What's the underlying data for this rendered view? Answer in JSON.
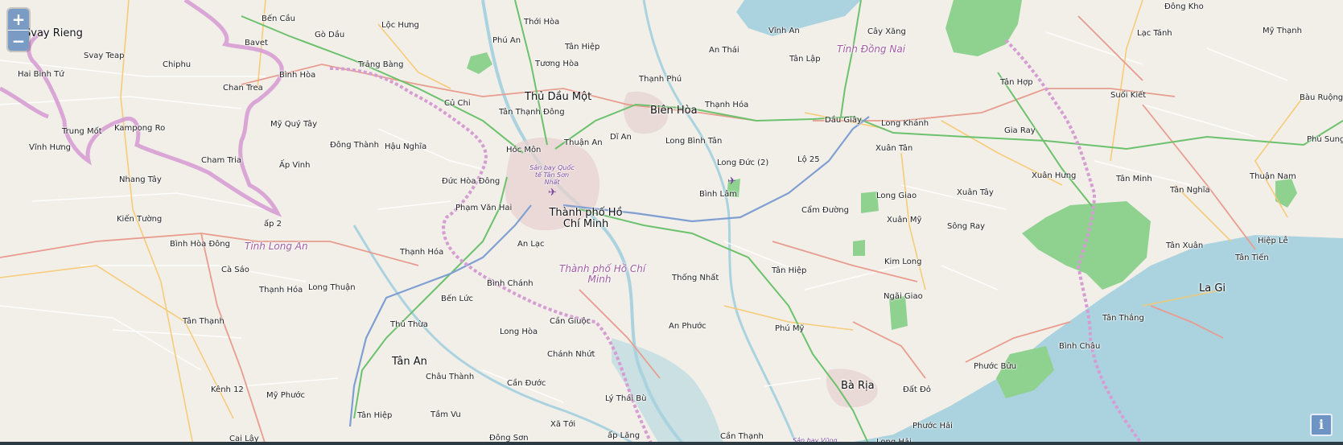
{
  "map": {
    "controls": {
      "zoom_in_label": "+",
      "zoom_out_label": "−",
      "info_label": "i",
      "zoom_in_icon": "plus-icon",
      "zoom_out_icon": "minus-icon",
      "info_icon": "info-icon"
    },
    "colors": {
      "land": "#f2efe9",
      "water": "#aad3df",
      "forest": "#8fd18f",
      "border": "#d69dd3",
      "motorway": "#7f9fd2",
      "trunk": "#6cc16c",
      "primary": "#e89c8e",
      "ui_button": "#7a9cc4"
    },
    "cities": {
      "hcmc_line1": "Thành phố Hồ",
      "hcmc_line2": "Chí Minh",
      "bien_hoa": "Biên Hòa",
      "thu_dau_mot": "Thủ Dầu Một",
      "tan_an": "Tân An",
      "ba_ria": "Bà Rịa",
      "la_gi": "La Gi",
      "svay_rieng": "Svay Rieng"
    },
    "regions": {
      "long_an": "Tỉnh Long An",
      "dong_nai": "Tỉnh Đồng Nai",
      "hcmc_line1": "Thành phố Hồ Chí",
      "hcmc_line2": "Minh"
    },
    "airport": {
      "line1": "Sân bay Quốc",
      "line2": "tế Tân Sơn",
      "line3": "Nhất",
      "vung": "Sân bay Vũng"
    },
    "places": {
      "p001": "Bến Cầu",
      "p002": "Gò Dầu",
      "p003": "Bavet",
      "p004": "Lộc Hưng",
      "p005": "Thới Hòa",
      "p006": "Phú An",
      "p007": "Tân Hiệp",
      "p008": "Tương Hòa",
      "p009": "Trảng Bàng",
      "p010": "Svay Teap",
      "p011": "Chiphu",
      "p012": "Hai Binh Tứ",
      "p013": "Chan Trea",
      "p014": "Bình Hòa",
      "p015": "Củ Chi",
      "p016": "Tân Thạnh Đông",
      "p017": "Trung Mốt",
      "p018": "Kampong Ro",
      "p019": "Mỹ Quý Tây",
      "p020": "Vĩnh Hưng",
      "p021": "Cham Tria",
      "p022": "Đông Thành",
      "p023": "Hậu Nghĩa",
      "p024": "Hóc Môn",
      "p025": "Thuận An",
      "p026": "Dĩ An",
      "p027": "Ấp Vinh",
      "p028": "Nhang Tây",
      "p029": "Đức Hòa Đông",
      "p030": "Phạm Văn Hai",
      "p031": "Kiến Tường",
      "p032": "ấp 2",
      "p033": "Bình Hòa Đông",
      "p034": "An Lạc",
      "p035": "Thạnh Hóa",
      "p036": "Cà Sáo",
      "p037": "Bình Chánh",
      "p038": "Thạnh Hóa",
      "p039": "Long Thuận",
      "p040": "Bến Lức",
      "p041": "Tân Thạnh",
      "p042": "Thủ Thừa",
      "p043": "Long Hòa",
      "p044": "Cần Giuộc",
      "p045": "Chánh Nhứt",
      "p046": "Châu Thành",
      "p047": "Cần Đước",
      "p048": "Kênh 12",
      "p049": "Mỹ Phước",
      "p050": "Tầm Vu",
      "p051": "Tân Hiệp",
      "p052": "Xã Tới",
      "p053": "Lý Thái Bù",
      "p054": "Cai Lậy",
      "p055": "Đông Sơn",
      "p056": "ấp Lăng",
      "p057": "Cần Thạnh",
      "p058": "Vĩnh An",
      "p059": "An Thái",
      "p060": "Cây Xăng",
      "p061": "Tân Lập",
      "p062": "Thạnh Phú",
      "p063": "Thạnh Hóa",
      "p064": "Long Bình Tân",
      "p065": "Long Đức (2)",
      "p066": "Lộ 25",
      "p067": "Dầu Giây",
      "p068": "Long Khánh",
      "p069": "Xuân Tân",
      "p070": "Bình Lâm",
      "p071": "Cẩm Đường",
      "p072": "Long Giao",
      "p073": "Xuân Mỹ",
      "p074": "Xuân Tây",
      "p075": "Sông Ray",
      "p076": "Kim Long",
      "p077": "Ngãi Giao",
      "p078": "Tân Hiệp",
      "p079": "Thống Nhất",
      "p080": "An Phước",
      "p081": "Phú Mỹ",
      "p082": "Đất Đỏ",
      "p083": "Phước Hải",
      "p084": "Long Hải",
      "p085": "Phước Bửu",
      "p086": "Bình Châu",
      "p087": "Tân Thắng",
      "p088": "Tân Hợp",
      "p089": "Gia Ray",
      "p090": "Xuân Hưng",
      "p091": "Suối Kiết",
      "p092": "Lạc Tánh",
      "p093": "Mỹ Thạnh",
      "p094": "Đông Kho",
      "p095": "Bàu Ruộng",
      "p096": "Phú Sung",
      "p097": "Tân Minh",
      "p098": "Tân Nghĩa",
      "p099": "Thuận Nam",
      "p100": "Hiệp Lễ",
      "p101": "Tân Xuân",
      "p102": "Tân Tiến"
    }
  }
}
